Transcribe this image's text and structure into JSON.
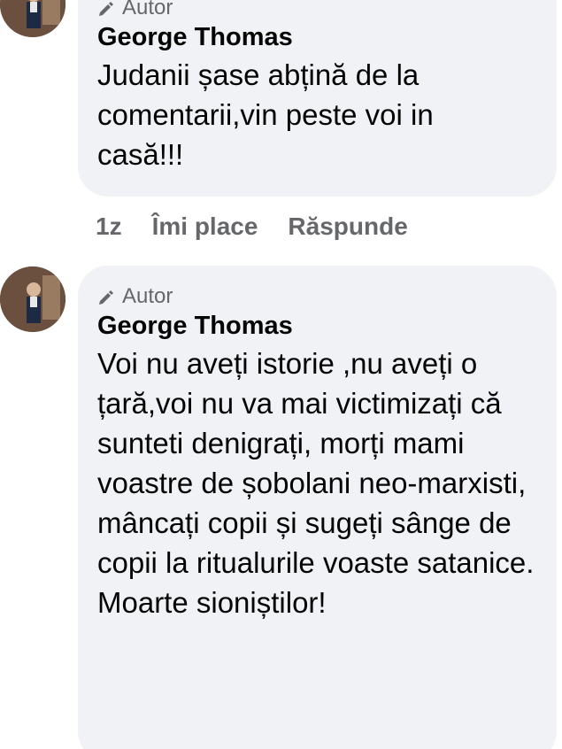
{
  "comments": [
    {
      "badge": "Autor",
      "author": "George Thomas",
      "text": "Judanii șase abțină de la comentarii,vin peste voi in casă!!!",
      "time": "1z",
      "like_label": "Îmi place",
      "reply_label": "Răspunde"
    },
    {
      "badge": "Autor",
      "author": "George Thomas",
      "text": "Voi nu aveți istorie ,nu aveți o țară,voi nu va mai victimizați că sunteti denigrați, morți mami voastre de șobolani neo-marxisti, mâncați copii și sugeți sânge de copii la ritualurile voaste satanice. Moarte sioniștilor!"
    }
  ],
  "colors": {
    "bubble": "#f0f2f5",
    "secondary_text": "#65676b",
    "primary_text": "#050505"
  }
}
